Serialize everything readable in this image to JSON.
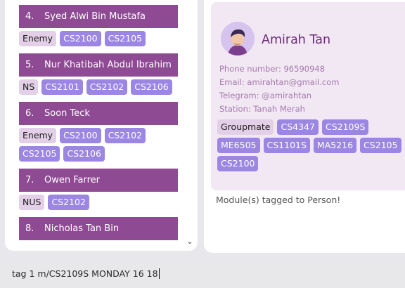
{
  "person_list": [
    {
      "index": "4.",
      "name": "Syed Alwi Bin Mustafa",
      "tags": [
        {
          "label": "Enemy",
          "kind": "relationship"
        },
        {
          "label": "CS2100",
          "kind": "module"
        },
        {
          "label": "CS2105",
          "kind": "module"
        }
      ]
    },
    {
      "index": "5.",
      "name": "Nur Khatibah Abdul Ibrahim",
      "tags": [
        {
          "label": "NS",
          "kind": "relationship"
        },
        {
          "label": "CS2101",
          "kind": "module"
        },
        {
          "label": "CS2102",
          "kind": "module"
        },
        {
          "label": "CS2106",
          "kind": "module"
        }
      ]
    },
    {
      "index": "6.",
      "name": "Soon Teck",
      "tags": [
        {
          "label": "Enemy",
          "kind": "relationship"
        },
        {
          "label": "CS2100",
          "kind": "module"
        },
        {
          "label": "CS2102",
          "kind": "module"
        },
        {
          "label": "CS2105",
          "kind": "module"
        },
        {
          "label": "CS2106",
          "kind": "module"
        }
      ]
    },
    {
      "index": "7.",
      "name": "Owen Farrer",
      "tags": [
        {
          "label": "NUS",
          "kind": "relationship"
        },
        {
          "label": "CS2102",
          "kind": "module"
        }
      ]
    },
    {
      "index": "8.",
      "name": "Nicholas Tan Bin",
      "tags": []
    }
  ],
  "detail": {
    "name": "Amirah Tan",
    "phone": "Phone number: 96590948",
    "email": "Email: amirahtan@gmail.com",
    "telegram": "Telegram: @amirahtan",
    "station": "Station: Tanah Merah",
    "tags": [
      {
        "label": "Groupmate",
        "kind": "relationship"
      },
      {
        "label": "CS4347",
        "kind": "module"
      },
      {
        "label": "CS2109S",
        "kind": "module"
      },
      {
        "label": "ME6505",
        "kind": "module"
      },
      {
        "label": "CS1101S",
        "kind": "module"
      },
      {
        "label": "MA5216",
        "kind": "module"
      },
      {
        "label": "CS2105",
        "kind": "module"
      },
      {
        "label": "CS2100",
        "kind": "module"
      }
    ]
  },
  "result_message": "Module(s) tagged to Person!",
  "command": {
    "value": "tag 1 m/CS2109S MONDAY  16 18"
  },
  "colors": {
    "card_header": "#8e4a93",
    "module_tag": "#9b86e3",
    "relationship_tag": "#e3cfe7",
    "detail_bg": "#f1e8f4",
    "name_accent": "#6b2a74"
  },
  "icons": {
    "scroll": "chevron-down-icon",
    "avatar": "avatar-illustration"
  }
}
